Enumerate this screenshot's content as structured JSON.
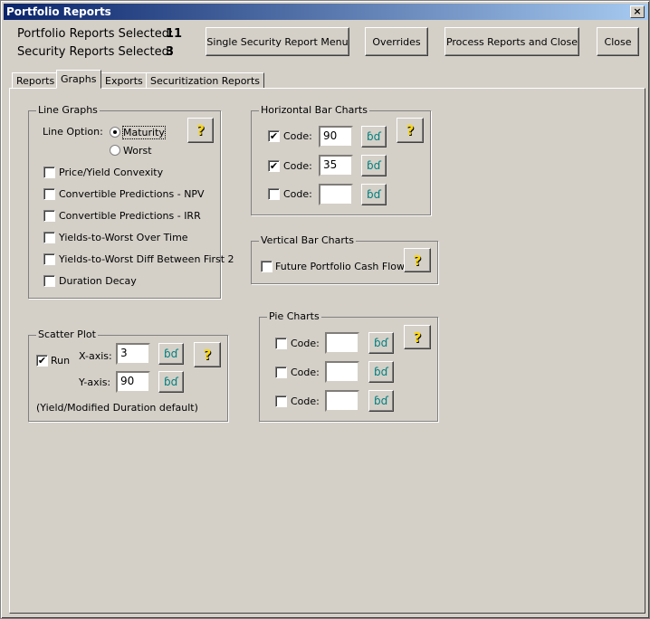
{
  "window": {
    "title": "Portfolio Reports",
    "close": "×"
  },
  "summary": {
    "portfolio_label": "Portfolio Reports Selected:",
    "portfolio_value": "11",
    "security_label": "Security Reports Selected:",
    "security_value": "3"
  },
  "buttons": {
    "single": "Single Security Report Menu",
    "overrides": "Overrides",
    "process": "Process Reports and Close",
    "close": "Close"
  },
  "tabs": [
    "Reports",
    "Graphs",
    "Exports",
    "Securitization Reports"
  ],
  "line_graphs": {
    "title": "Line Graphs",
    "option_label": "Line Option:",
    "radios": [
      {
        "label": "Maturity",
        "checked": true
      },
      {
        "label": "Worst",
        "checked": false
      }
    ],
    "items": [
      {
        "label": "Price/Yield Convexity",
        "checked": false
      },
      {
        "label": "Convertible Predictions - NPV",
        "checked": false
      },
      {
        "label": "Convertible Predictions - IRR",
        "checked": false
      },
      {
        "label": "Yields-to-Worst Over Time",
        "checked": false
      },
      {
        "label": "Yields-to-Worst Diff Between First 2",
        "checked": false
      },
      {
        "label": "Duration Decay",
        "checked": false
      }
    ]
  },
  "hbar": {
    "title": "Horizontal Bar Charts",
    "rows": [
      {
        "label": "Code:",
        "value": "90",
        "checked": true
      },
      {
        "label": "Code:",
        "value": "35",
        "checked": true
      },
      {
        "label": "Code:",
        "value": "",
        "checked": false
      }
    ]
  },
  "vbar": {
    "title": "Vertical Bar Charts",
    "item": "Future Portfolio Cash Flows",
    "checked": false
  },
  "scatter": {
    "title": "Scatter Plot",
    "run": "Run",
    "run_checked": true,
    "x_label": "X-axis:",
    "x_value": "3",
    "y_label": "Y-axis:",
    "y_value": "90",
    "note": "(Yield/Modified Duration default)"
  },
  "pie": {
    "title": "Pie Charts",
    "rows": [
      {
        "label": "Code:",
        "value": "",
        "checked": false
      },
      {
        "label": "Code:",
        "value": "",
        "checked": false
      },
      {
        "label": "Code:",
        "value": "",
        "checked": false
      }
    ]
  },
  "icons": {
    "help": "?",
    "lookup": "ɓɗ",
    "check": "✔"
  }
}
